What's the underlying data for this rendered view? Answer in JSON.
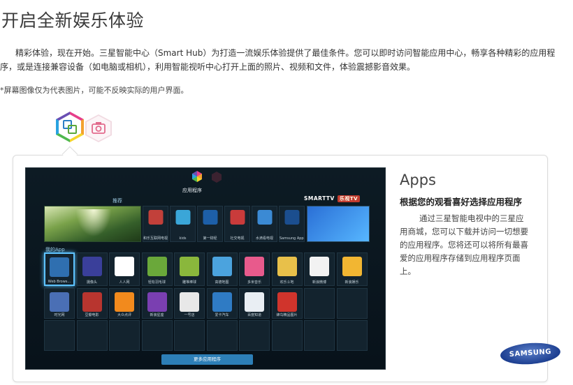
{
  "page": {
    "title": "开启全新娱乐体验",
    "intro": "精彩体验，现在开始。三星智能中心（Smart Hub）为打造一流娱乐体验提供了最佳条件。您可以即时访问智能应用中心，畅享各种精彩的应用程序，或是连接兼容设备（如电脑或相机），利用智能视听中心打开上面的照片、视频和文件，体验震撼影音效果。",
    "disclaimer": "*屏幕图像仅为代表图片，可能不反映实际的用户界面。"
  },
  "tabs": [
    {
      "name": "apps",
      "icon": "apps-hex-icon",
      "selected": true
    },
    {
      "name": "camera",
      "icon": "camera-hex-icon",
      "selected": false
    }
  ],
  "tv": {
    "tab_label": "应用程序",
    "recommended_label": "推荐",
    "my_apps_label": "我的App",
    "smarttv_logo": "SMARTTV",
    "logo_badge": "乐视TV",
    "recommended": [
      {
        "label": "和乐互联网电视",
        "color": "#c2403a"
      },
      {
        "label": "kids",
        "color": "#3aa6d8"
      },
      {
        "label": "第一财经",
        "color": "#1d5fa8"
      },
      {
        "label": "社交电视",
        "color": "#c93b3b"
      },
      {
        "label": "水滴看电视",
        "color": "#3b8ad4"
      },
      {
        "label": "Samsung Apps",
        "color": "#1b4e8f"
      }
    ],
    "my_apps_row1": [
      {
        "label": "Web Brows...",
        "color": "#2f6fb0"
      },
      {
        "label": "摄像头",
        "color": "#3a3f9a"
      },
      {
        "label": "人人网",
        "color": "#ffffff"
      },
      {
        "label": "轻松羽毛球",
        "color": "#6aa83a"
      },
      {
        "label": "雕堆棒球",
        "color": "#8ab73c"
      },
      {
        "label": "高德地图",
        "color": "#4ba3de"
      },
      {
        "label": "多米音乐",
        "color": "#e85a8c"
      },
      {
        "label": "欢乐斗地",
        "color": "#e8c04a"
      },
      {
        "label": "新浪微博",
        "color": "#f2f2f2"
      },
      {
        "label": "新浪娱乐",
        "color": "#f2b632"
      }
    ],
    "my_apps_row2": [
      {
        "label": "时光网",
        "color": "#4a6fb5"
      },
      {
        "label": "豆瓣电影",
        "color": "#b8352f"
      },
      {
        "label": "大众点评",
        "color": "#f28a1d"
      },
      {
        "label": "新浪星座",
        "color": "#7a3fb1"
      },
      {
        "label": "一号店",
        "color": "#e8e8e8"
      },
      {
        "label": "爱卡汽车",
        "color": "#2f7bc4"
      },
      {
        "label": "百度知道",
        "color": "#e9eef3"
      },
      {
        "label": "蜂鸟精品图片",
        "color": "#d0342c"
      }
    ],
    "more_button": "更多应用程序"
  },
  "panel": {
    "title": "Apps",
    "subtitle": "根据您的观看喜好选择应用程序",
    "body": "通过三星智能电视中的三星应用商城，您可以下载并访问一切想要的应用程序。您将还可以将所有最喜爱的应用程序存储到应用程序页面上。"
  },
  "brand": {
    "logo_text": "SAMSUNG",
    "color": "#1d3f91"
  }
}
